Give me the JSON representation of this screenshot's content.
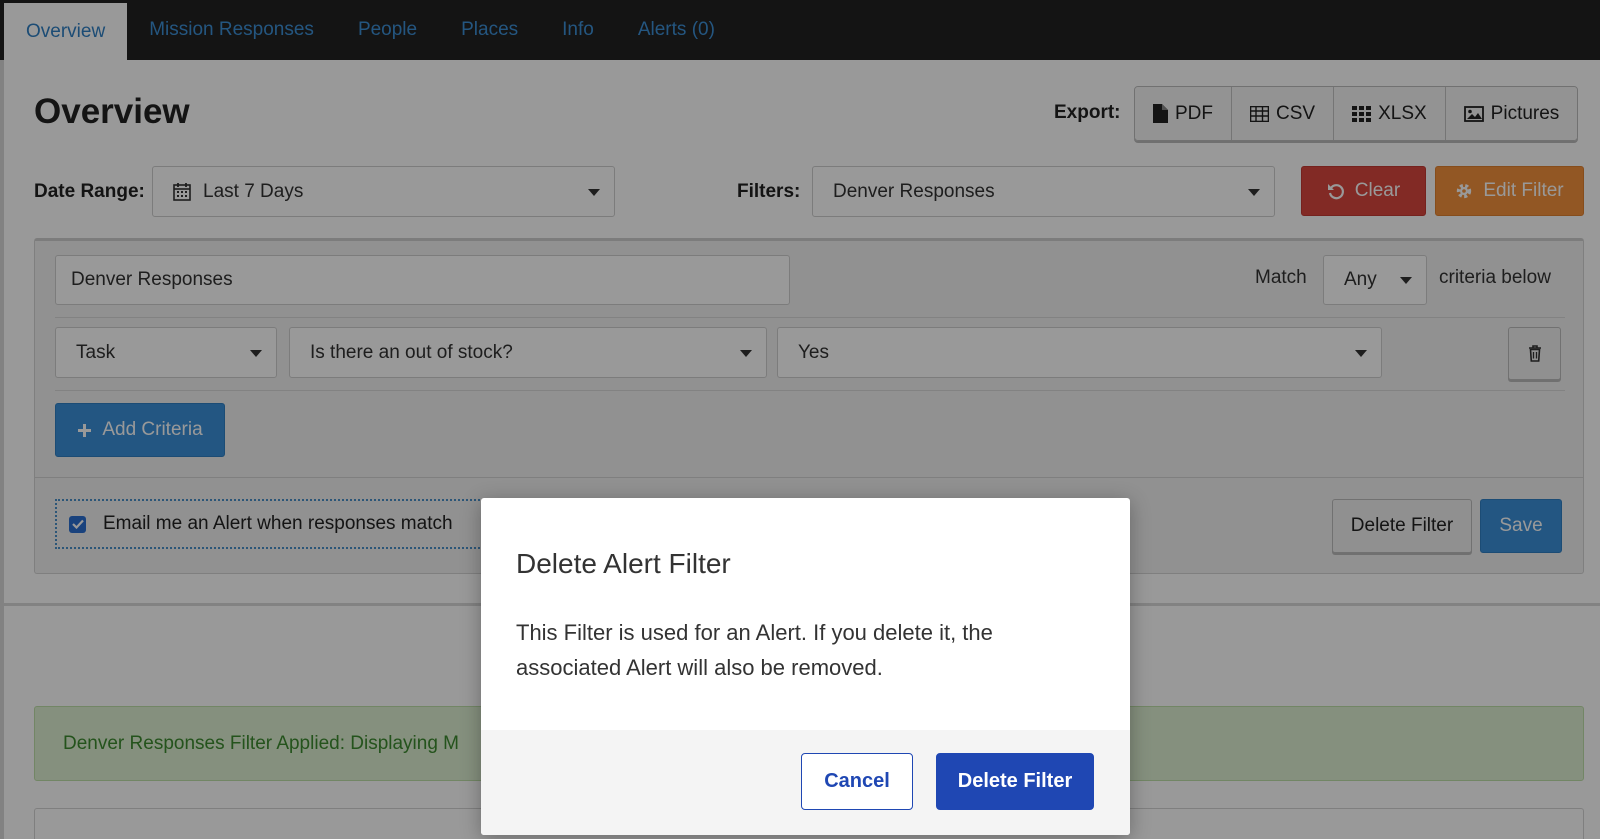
{
  "nav": {
    "tabs": [
      {
        "label": "Overview",
        "active": true
      },
      {
        "label": "Mission Responses"
      },
      {
        "label": "People"
      },
      {
        "label": "Places"
      },
      {
        "label": "Info"
      },
      {
        "label": "Alerts (0)"
      }
    ]
  },
  "header": {
    "title": "Overview",
    "export_label": "Export:",
    "export_buttons": [
      {
        "label": "PDF",
        "icon": "file-icon"
      },
      {
        "label": "CSV",
        "icon": "table-icon"
      },
      {
        "label": "XLSX",
        "icon": "grid-icon"
      },
      {
        "label": "Pictures",
        "icon": "image-icon"
      }
    ]
  },
  "toolbar": {
    "date_range_label": "Date Range:",
    "date_range_value": "Last 7 Days",
    "filters_label": "Filters:",
    "filters_value": "Denver Responses",
    "clear_label": "Clear",
    "edit_filter_label": "Edit Filter"
  },
  "filter_editor": {
    "name": "Denver Responses",
    "match_label": "Match",
    "match_value": "Any",
    "criteria_suffix": "criteria below",
    "criteria": {
      "field": "Task",
      "question": "Is there an out of stock?",
      "answer": "Yes"
    },
    "add_criteria_label": "Add Criteria",
    "email_alert_label": "Email me an Alert when responses match",
    "email_alert_checked": true,
    "delete_filter_label": "Delete Filter",
    "save_label": "Save"
  },
  "banner": {
    "text": "Denver Responses Filter Applied: Displaying M"
  },
  "modal": {
    "title": "Delete Alert Filter",
    "body": "This Filter is used for an Alert. If you delete it, the associated Alert will also be removed.",
    "cancel_label": "Cancel",
    "confirm_label": "Delete Filter"
  },
  "colors": {
    "nav_bg": "#222222",
    "link": "#3d8fd6",
    "danger": "#d9463f",
    "warning": "#f4913c",
    "primary": "#3b8fd9",
    "modal_primary": "#1f47b3",
    "success_bg": "#def0d2"
  }
}
